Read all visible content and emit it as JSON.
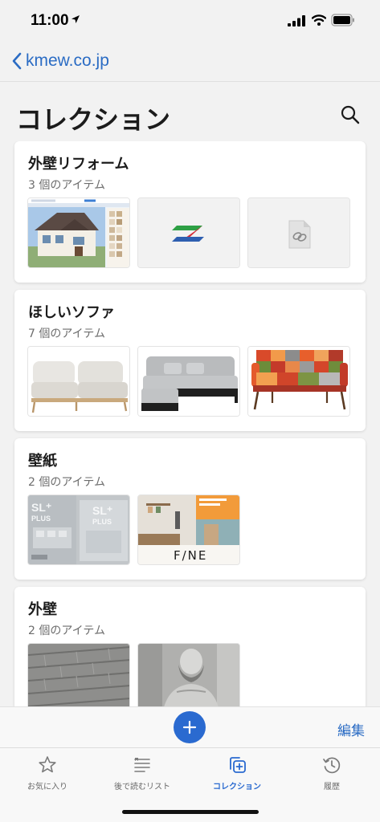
{
  "status": {
    "time": "11:00"
  },
  "nav": {
    "back_label": "kmew.co.jp"
  },
  "page": {
    "title": "コレクション"
  },
  "collections": [
    {
      "title": "外壁リフォーム",
      "count": "3 個のアイテム"
    },
    {
      "title": "ほしいソファ",
      "count": "7 個のアイテム"
    },
    {
      "title": "壁紙",
      "count": "2 個のアイテム",
      "thumb_text": {
        "plus": "SL⁺\nPLUS",
        "fine": "F/NE"
      }
    },
    {
      "title": "外壁",
      "count": "2 個のアイテム"
    }
  ],
  "toolbar": {
    "edit_label": "編集"
  },
  "tabs": [
    {
      "label": "お気に入り",
      "icon": "star-icon"
    },
    {
      "label": "後で読むリスト",
      "icon": "reading-list-icon"
    },
    {
      "label": "コレクション",
      "icon": "collections-icon",
      "active": true
    },
    {
      "label": "履歴",
      "icon": "history-icon"
    }
  ],
  "colors": {
    "accent": "#2a6ad0",
    "link": "#2b6cc4",
    "background": "#f2f2f2"
  }
}
